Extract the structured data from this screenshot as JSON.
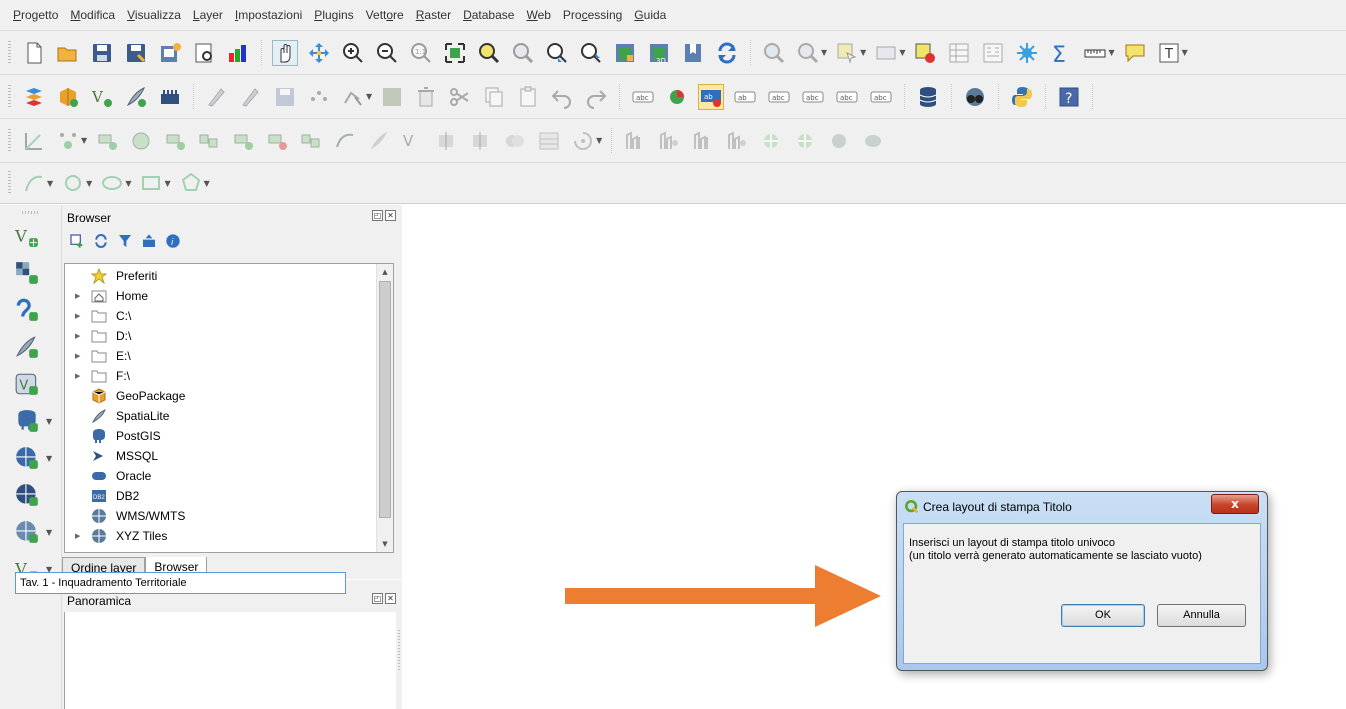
{
  "menubar": {
    "items": [
      {
        "u": "P",
        "rest": "rogetto"
      },
      {
        "u": "M",
        "rest": "odifica"
      },
      {
        "u": "V",
        "rest": "isualizza"
      },
      {
        "u": "L",
        "rest": "ayer"
      },
      {
        "u": "I",
        "rest": "mpostazioni"
      },
      {
        "u": "P",
        "rest": "lugins"
      },
      {
        "pre": "Vett",
        "u": "o",
        "rest": "re"
      },
      {
        "u": "R",
        "rest": "aster"
      },
      {
        "u": "D",
        "rest": "atabase"
      },
      {
        "u": "W",
        "rest": "eb"
      },
      {
        "pre": "Pro",
        "u": "c",
        "rest": "essing"
      },
      {
        "u": "G",
        "rest": "uida"
      }
    ]
  },
  "browser": {
    "title": "Browser",
    "tree": [
      {
        "label": "Preferiti",
        "icon": "star-icon",
        "arrow": false
      },
      {
        "label": "Home",
        "icon": "home-folder-icon",
        "arrow": true
      },
      {
        "label": "C:\\",
        "icon": "folder-icon",
        "arrow": true
      },
      {
        "label": "D:\\",
        "icon": "folder-icon",
        "arrow": true
      },
      {
        "label": "E:\\",
        "icon": "folder-icon",
        "arrow": true
      },
      {
        "label": "F:\\",
        "icon": "folder-icon",
        "arrow": true
      },
      {
        "label": "GeoPackage",
        "icon": "geopackage-icon",
        "arrow": false
      },
      {
        "label": "SpatiaLite",
        "icon": "spatialite-feather-icon",
        "arrow": false
      },
      {
        "label": "PostGIS",
        "icon": "postgis-elephant-icon",
        "arrow": false
      },
      {
        "label": "MSSQL",
        "icon": "mssql-icon",
        "arrow": false
      },
      {
        "label": "Oracle",
        "icon": "oracle-icon",
        "arrow": false
      },
      {
        "label": "DB2",
        "icon": "db2-icon",
        "arrow": false
      },
      {
        "label": "WMS/WMTS",
        "icon": "globe-icon",
        "arrow": false
      },
      {
        "label": "XYZ Tiles",
        "icon": "globe-icon",
        "arrow": true
      }
    ],
    "tabs": [
      "Ordine layer",
      "Browser"
    ]
  },
  "panoramica": {
    "title": "Panoramica"
  },
  "dialog": {
    "title": "Crea layout di stampa Titolo",
    "close": "x",
    "message_line1": "Inserisci un layout di stampa titolo univoco",
    "message_line2": "(un titolo verrà generato automaticamente se lasciato vuoto)",
    "input_value": "Tav. 1 - Inquadramento Territoriale",
    "ok": "OK",
    "cancel": "Annulla"
  },
  "colors": {
    "arrow": "#ed7d31",
    "dialog_frame": "#a9c7ec",
    "close_button": "#c7432a"
  }
}
